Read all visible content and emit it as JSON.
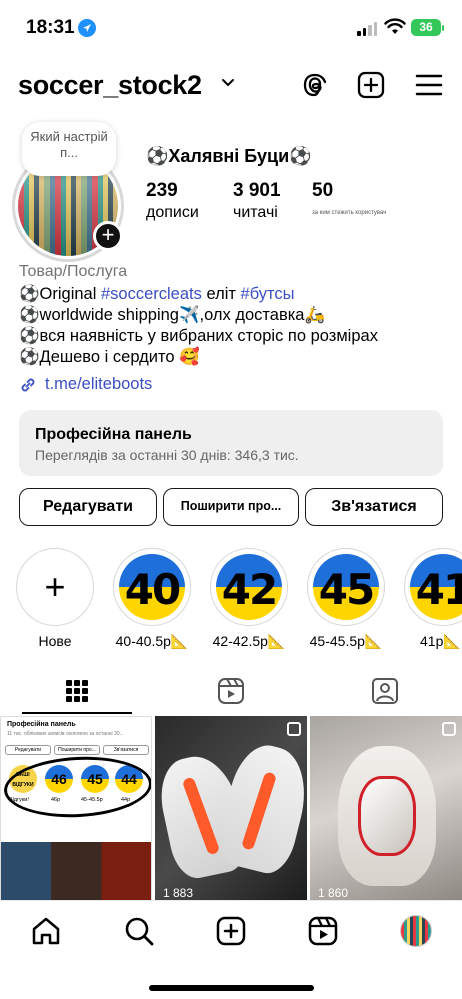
{
  "status_bar": {
    "time": "18:31",
    "battery": "36"
  },
  "header": {
    "username": "soccer_stock2"
  },
  "profile": {
    "note": "Який настрій п...",
    "display_name": "⚽️Халявні Буци⚽️",
    "stats": [
      {
        "value": "239",
        "label": "дописи"
      },
      {
        "value": "3 901",
        "label": "читачі"
      },
      {
        "value": "50",
        "label": "за ким стежить користувач"
      }
    ],
    "category": "Товар/Послуга",
    "bio": {
      "line1_prefix": "⚽️Original ",
      "line1_tag1": "#soccercleats",
      "line1_mid": " еліт ",
      "line1_tag2": "#бутсы",
      "line2": "⚽️worldwide shipping✈️,олх доставка🛵",
      "line3": "⚽️вся наявність у вибраних сторіс по розмірах",
      "line4": "⚽️Дешево і сердито 🥰"
    },
    "link": "t.me/eliteboots"
  },
  "pro_panel": {
    "title": "Професійна панель",
    "subtitle": "Переглядів за останні 30 днів: 346,3 тис."
  },
  "buttons": {
    "edit": "Редагувати",
    "share": "Поширити про...",
    "contact": "Зв'язатися"
  },
  "highlights": [
    {
      "label": "Нове",
      "number": ""
    },
    {
      "label": "40-40.5р📐",
      "number": "40"
    },
    {
      "label": "42-42.5р📐",
      "number": "42"
    },
    {
      "label": "45-45.5р📐",
      "number": "45"
    },
    {
      "label": "41р📐",
      "number": "41"
    }
  ],
  "grid": {
    "tile1": {
      "title": "Професійна панель",
      "subtitle": "11 тис. облікових записів охоплено за останні 30...",
      "btn1": "Редагувати",
      "btn2": "Поширити про...",
      "btn3": "Зв'язатися",
      "circle1": "ВАШІ ВІДГУКИ",
      "circle2": "46",
      "circle3": "45",
      "circle4": "44",
      "cap1": "Відгуки!",
      "cap2": "46р",
      "cap3": "45-45.5р",
      "cap4": "44р"
    },
    "tile2": {
      "likes": "1 883"
    },
    "tile3": {
      "likes": "1 860"
    }
  },
  "colors": {
    "link": "#3b4fc4",
    "ukraine_blue": "#1e6fd9",
    "ukraine_yellow": "#ffd500",
    "battery": "#34c759"
  }
}
